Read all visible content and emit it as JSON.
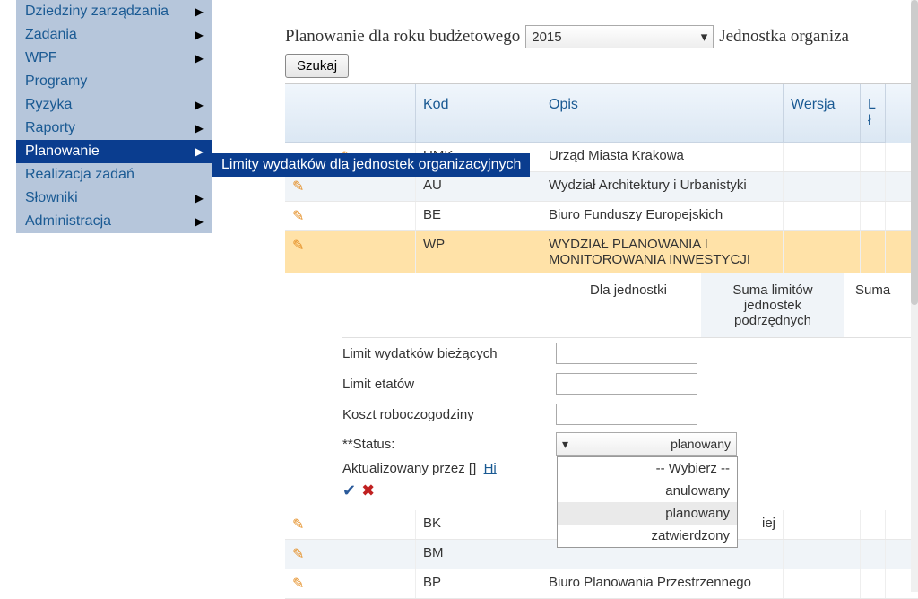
{
  "sidebar": {
    "items": [
      {
        "label": "Dziedziny zarządzania",
        "arrow": true
      },
      {
        "label": "Zadania",
        "arrow": true
      },
      {
        "label": "WPF",
        "arrow": true
      },
      {
        "label": "Programy",
        "arrow": false
      },
      {
        "label": "Ryzyka",
        "arrow": true
      },
      {
        "label": "Raporty",
        "arrow": true
      },
      {
        "label": "Planowanie",
        "arrow": true,
        "active": true
      },
      {
        "label": "Realizacja zadań",
        "arrow": false
      },
      {
        "label": "Słowniki",
        "arrow": true
      },
      {
        "label": "Administracja",
        "arrow": true
      }
    ]
  },
  "submenu": {
    "label": "Limity wydatków dla jednostek organizacyjnych"
  },
  "header": {
    "planning_label": "Planowanie dla roku budżetowego",
    "year": "2015",
    "org_label": "Jednostka organiza",
    "search_btn": "Szukaj"
  },
  "grid": {
    "headers": {
      "kod": "Kod",
      "opis": "Opis",
      "wersja": "Wersja",
      "last": "L ł"
    },
    "rows": [
      {
        "kod": "UMK",
        "opis": "Urząd Miasta Krakowa",
        "level": 0,
        "toggle": "−"
      },
      {
        "kod": "AU",
        "opis": "Wydział Architektury i Urbanistyki",
        "level": 1,
        "alt": true
      },
      {
        "kod": "BE",
        "opis": "Biuro Funduszy Europejskich",
        "level": 1
      },
      {
        "kod": "WP",
        "opis": "WYDZIAŁ PLANOWANIA I MONITOROWANIA INWESTYCJI",
        "level": 1,
        "sel": true
      },
      {
        "kod": "BK",
        "opis": "iej",
        "level": 1
      },
      {
        "kod": "BM",
        "opis": "",
        "level": 1,
        "alt": true
      },
      {
        "kod": "BP",
        "opis": "Biuro Planowania Przestrzennego",
        "level": 1
      }
    ]
  },
  "detail": {
    "headers": {
      "dla": "Dla jednostki",
      "suma_pod": "Suma limitów jednostek podrzędnych",
      "suma": "Suma"
    },
    "rows": [
      {
        "label": "Limit wydatków bieżących",
        "value": ""
      },
      {
        "label": "Limit etatów",
        "value": ""
      },
      {
        "label": "Koszt roboczogodziny",
        "value": ""
      }
    ],
    "status": {
      "label": "**Status:",
      "value": "planowany"
    },
    "dropdown": [
      "-- Wybierz --",
      "anulowany",
      "planowany",
      "zatwierdzony"
    ],
    "updated_prefix": "Aktualizowany przez []",
    "history_link": "Hi"
  }
}
